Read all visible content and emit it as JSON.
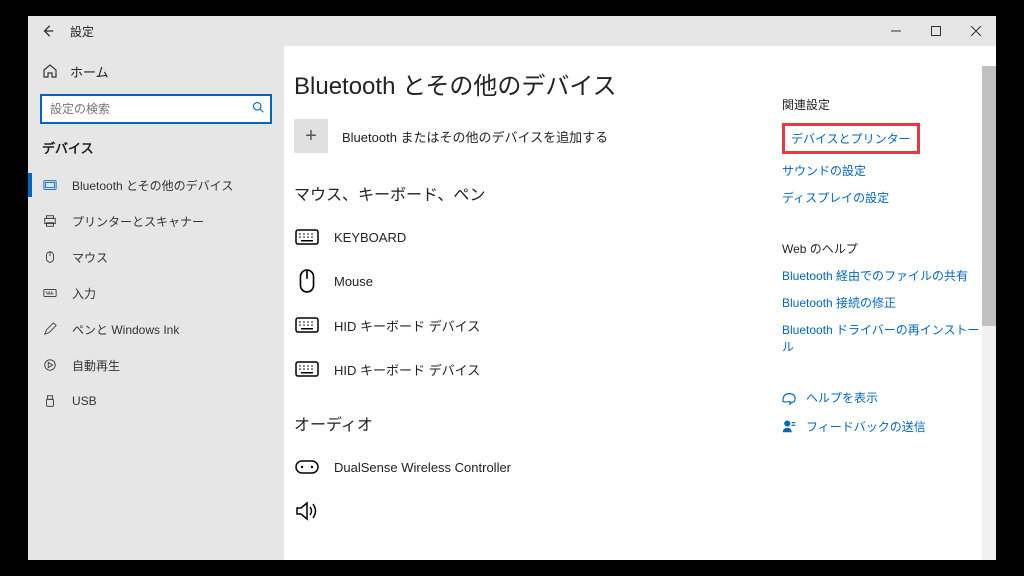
{
  "titlebar": {
    "title": "設定"
  },
  "sidebar": {
    "home": "ホーム",
    "search_placeholder": "設定の検索",
    "category_label": "デバイス",
    "items": [
      {
        "label": "Bluetooth とその他のデバイス"
      },
      {
        "label": "プリンターとスキャナー"
      },
      {
        "label": "マウス"
      },
      {
        "label": "入力"
      },
      {
        "label": "ペンと Windows Ink"
      },
      {
        "label": "自動再生"
      },
      {
        "label": "USB"
      }
    ]
  },
  "main": {
    "page_title": "Bluetooth とその他のデバイス",
    "add_label": "Bluetooth またはその他のデバイスを追加する",
    "section1_heading": "マウス、キーボード、ペン",
    "devices": [
      {
        "label": "KEYBOARD"
      },
      {
        "label": "Mouse"
      },
      {
        "label": "HID キーボード デバイス"
      },
      {
        "label": "HID キーボード デバイス"
      }
    ],
    "section2_heading": "オーディオ",
    "audio_devices": [
      {
        "label": "DualSense Wireless Controller"
      }
    ]
  },
  "right": {
    "heading1": "関連設定",
    "link1": "デバイスとプリンター",
    "link2": "サウンドの設定",
    "link3": "ディスプレイの設定",
    "heading2": "Web のヘルプ",
    "weblink1": "Bluetooth 経由でのファイルの共有",
    "weblink2": "Bluetooth 接続の修正",
    "weblink3": "Bluetooth ドライバーの再インストール",
    "help": "ヘルプを表示",
    "feedback": "フィードバックの送信"
  }
}
